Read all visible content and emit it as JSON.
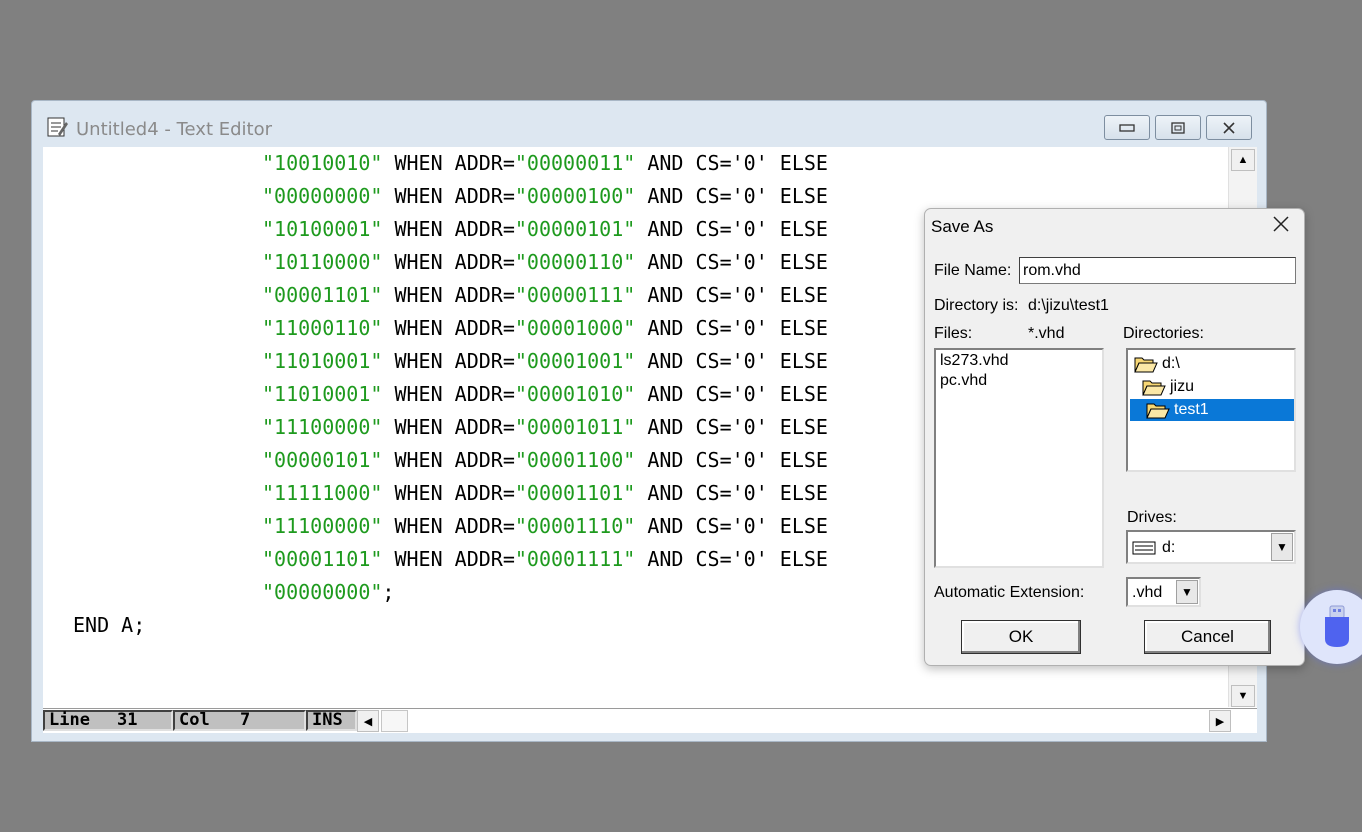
{
  "window": {
    "title": "Untitled4 - Text Editor",
    "controls": {
      "minimize": "▭",
      "restore": "⧉",
      "close": "✕"
    }
  },
  "code": {
    "lines": [
      {
        "str": "\"10010010\"",
        "mid": " WHEN ADDR=",
        "addr": "\"00000011\"",
        "tail": " AND CS='0' ELSE"
      },
      {
        "str": "\"00000000\"",
        "mid": " WHEN ADDR=",
        "addr": "\"00000100\"",
        "tail": " AND CS='0' ELSE"
      },
      {
        "str": "\"10100001\"",
        "mid": " WHEN ADDR=",
        "addr": "\"00000101\"",
        "tail": " AND CS='0' ELSE"
      },
      {
        "str": "\"10110000\"",
        "mid": " WHEN ADDR=",
        "addr": "\"00000110\"",
        "tail": " AND CS='0' ELSE"
      },
      {
        "str": "\"00001101\"",
        "mid": " WHEN ADDR=",
        "addr": "\"00000111\"",
        "tail": " AND CS='0' ELSE"
      },
      {
        "str": "\"11000110\"",
        "mid": " WHEN ADDR=",
        "addr": "\"00001000\"",
        "tail": " AND CS='0' ELSE"
      },
      {
        "str": "\"11010001\"",
        "mid": " WHEN ADDR=",
        "addr": "\"00001001\"",
        "tail": " AND CS='0' ELSE"
      },
      {
        "str": "\"11010001\"",
        "mid": " WHEN ADDR=",
        "addr": "\"00001010\"",
        "tail": " AND CS='0' ELSE"
      },
      {
        "str": "\"11100000\"",
        "mid": " WHEN ADDR=",
        "addr": "\"00001011\"",
        "tail": " AND CS='0' ELSE"
      },
      {
        "str": "\"00000101\"",
        "mid": " WHEN ADDR=",
        "addr": "\"00001100\"",
        "tail": " AND CS='0' ELSE"
      },
      {
        "str": "\"11111000\"",
        "mid": " WHEN ADDR=",
        "addr": "\"00001101\"",
        "tail": " AND CS='0' ELSE"
      },
      {
        "str": "\"11100000\"",
        "mid": " WHEN ADDR=",
        "addr": "\"00001110\"",
        "tail": " AND CS='0' ELSE"
      },
      {
        "str": "\"00001101\"",
        "mid": " WHEN ADDR=",
        "addr": "\"00001111\"",
        "tail": " AND CS='0' ELSE"
      },
      {
        "str": "\"00000000\"",
        "mid": ";",
        "addr": "",
        "tail": ""
      }
    ],
    "end_line": "END A;"
  },
  "status": {
    "line_label": "Line",
    "line_value": "31",
    "col_label": "Col",
    "col_value": "7",
    "mode": "INS"
  },
  "dialog": {
    "title": "Save As",
    "file_name_label": "File Name:",
    "file_name_value": "rom.vhd",
    "directory_label": "Directory is:",
    "directory_value": "d:\\jizu\\test1",
    "files_label": "Files:",
    "files_filter": "*.vhd",
    "files": [
      "ls273.vhd",
      "pc.vhd"
    ],
    "directories_label": "Directories:",
    "directories": [
      "d:\\",
      "jizu",
      "test1"
    ],
    "drives_label": "Drives:",
    "drive_value": "d:",
    "auto_ext_label": "Automatic Extension:",
    "auto_ext_value": ".vhd",
    "ok_label": "OK",
    "cancel_label": "Cancel"
  },
  "colors": {
    "string_literal": "#1e9a1e",
    "selection": "#0a78d7",
    "desktop": "#808080"
  }
}
